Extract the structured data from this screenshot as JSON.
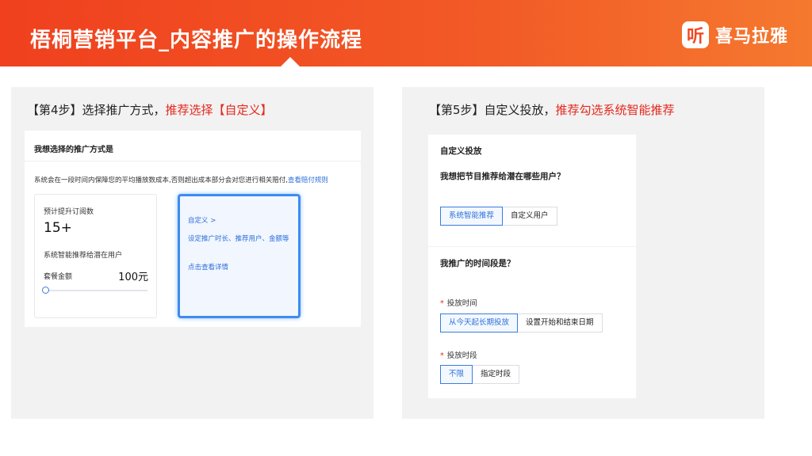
{
  "header": {
    "title": "梧桐营销平台_内容推广的操作流程",
    "logo_mark": "听",
    "logo_text": "喜马拉雅"
  },
  "left": {
    "step_prefix": "【第4步】选择推广方式，",
    "step_highlight": "推荐选择【自定义】",
    "card_title": "我想选择的推广方式是",
    "description": "系统会在一段时间内保障您的平均播放数成本,否则超出成本部分会对您进行相关赔付,",
    "description_link": "查看赔付规则",
    "package": {
      "label": "预计提升订阅数",
      "value": "15+",
      "target": "系统智能推荐给潜在用户",
      "amount_label": "套餐金额",
      "amount": "100元"
    },
    "custom": {
      "title": "自定义 >",
      "detail": "设定推广时长、推荐用户、金额等",
      "link": "点击查看详情"
    }
  },
  "right": {
    "step_prefix": "【第5步】自定义投放，",
    "step_highlight": "推荐勾选系统智能推荐",
    "card_title": "自定义投放",
    "question_users": "我想把节目推荐给潜在哪些用户？",
    "audience_options": [
      "系统智能推荐",
      "自定义用户"
    ],
    "question_time": "我推广的时间段是？",
    "launch_time_label": "投放时间",
    "launch_time_options": [
      "从今天起长期投放",
      "设置开始和结束日期"
    ],
    "period_label": "投放时段",
    "period_options": [
      "不限",
      "指定时段"
    ],
    "required_mark": "*"
  },
  "colors": {
    "header_start": "#f0401e",
    "header_end": "#f5792f",
    "highlight_red": "#e5281d",
    "link_blue": "#2e6fd9",
    "selection_border": "#3d8cf0"
  },
  "icons": [
    "logo-ting-icon",
    "chevron-right-icon",
    "slider-knob"
  ]
}
